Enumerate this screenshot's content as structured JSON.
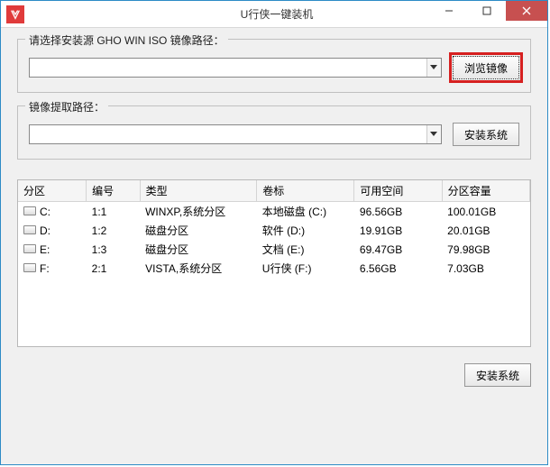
{
  "window": {
    "title": "U行侠一键装机"
  },
  "source": {
    "legend": "请选择安装源 GHO WIN ISO 镜像路径：",
    "value": "",
    "browse_label": "浏览镜像"
  },
  "extract": {
    "legend": "镜像提取路径：",
    "value": "",
    "install_label": "安装系统"
  },
  "table": {
    "headers": {
      "drive": "分区",
      "id": "编号",
      "type": "类型",
      "label": "卷标",
      "free": "可用空间",
      "total": "分区容量"
    },
    "rows": [
      {
        "drive": "C:",
        "id": "1:1",
        "type": "WINXP,系统分区",
        "label": "本地磁盘 (C:)",
        "free": "96.56GB",
        "total": "100.01GB"
      },
      {
        "drive": "D:",
        "id": "1:2",
        "type": "磁盘分区",
        "label": "软件 (D:)",
        "free": "19.91GB",
        "total": "20.01GB"
      },
      {
        "drive": "E:",
        "id": "1:3",
        "type": "磁盘分区",
        "label": "文档 (E:)",
        "free": "69.47GB",
        "total": "79.98GB"
      },
      {
        "drive": "F:",
        "id": "2:1",
        "type": "VISTA,系统分区",
        "label": "U行侠 (F:)",
        "free": "6.56GB",
        "total": "7.03GB"
      }
    ]
  },
  "footer": {
    "install_label": "安装系统"
  }
}
